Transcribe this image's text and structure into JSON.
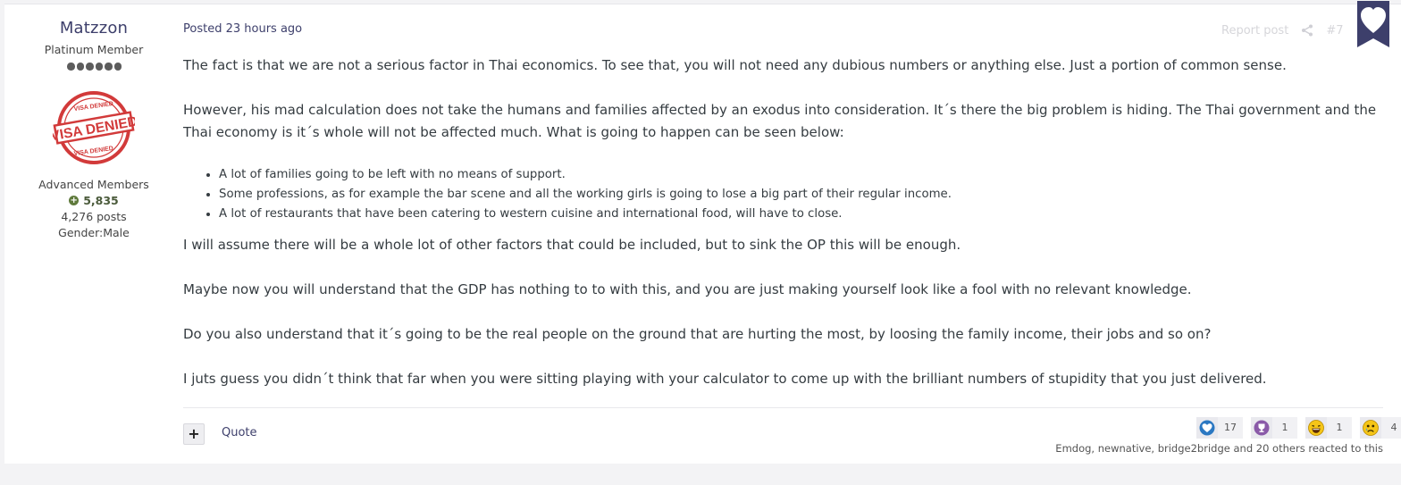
{
  "author": {
    "name": "Matzzon",
    "title": "Platinum Member",
    "rank_pips": 6,
    "avatar_text_top": "VISA DENIED",
    "avatar_text_main": "VISA DENIED",
    "avatar_text_bottom": "VISA DENIED",
    "group": "Advanced Members",
    "reputation": "5,835",
    "posts": "4,276 posts",
    "gender": "Gender:Male"
  },
  "post": {
    "posted_prefix": "Posted",
    "posted_time": "23 hours ago",
    "report_label": "Report post",
    "post_number": "#7",
    "paragraphs": [
      "The fact is that we are not a serious factor in Thai economics. To see that, you will not need any dubious numbers or anything else. Just a portion of common sense.",
      "However, his mad calculation does not take the humans and families affected by an exodus into consideration. It´s there the big problem is hiding. The Thai government and the Thai economy is it´s whole will not be affected much. What is going to happen can be seen below:"
    ],
    "bullets": [
      "A lot of families going to be left with no means of support.",
      "Some professions, as for example the bar scene and all the working girls is going to lose a big part of their regular income.",
      "A lot of restaurants that have been catering to western cuisine and international food, will have to close."
    ],
    "after_paragraphs": [
      "I will assume there will be a whole lot of other factors that could be included, but to sink the OP this will be enough.",
      "Maybe now you will understand that the GDP has nothing to to with this, and you are just making yourself look like a fool with no relevant knowledge.",
      "Do you also understand that it´s going to be the real people on the ground that are hurting the most, by loosing the family income, their jobs and so on?",
      "I juts guess you didn´t think that far when you were sitting playing with your calculator to come up with the brilliant numbers of stupidity that you just delivered."
    ]
  },
  "footer": {
    "multiquote_label": "+",
    "quote_label": "Quote",
    "reactions": [
      {
        "name": "like",
        "count": "17"
      },
      {
        "name": "thanks",
        "count": "1"
      },
      {
        "name": "haha",
        "count": "1"
      },
      {
        "name": "sad",
        "count": "4"
      }
    ],
    "reacted_text": "Emdog, newnative, bridge2bridge and 20 others reacted to this"
  },
  "colors": {
    "accent": "#3d3f6b",
    "bookmark": "#3d3f6b",
    "stamp_red": "#d23a3a",
    "like_blue": "#2b78c2",
    "thanks_purple": "#8a5aa8",
    "emoji_yellow": "#f5c518"
  }
}
